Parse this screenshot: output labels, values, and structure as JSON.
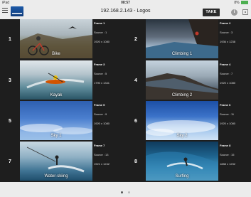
{
  "status": {
    "device": "iPad",
    "time": "08:57",
    "battery": "8%"
  },
  "nav": {
    "title": "192.168.2.143 - Logos",
    "take_label": "TAKE",
    "info_glyph": "i"
  },
  "frames": [
    {
      "num": "1",
      "caption": "Bike",
      "frame": "Frame 1",
      "source": "Source : 1",
      "size": "1920 x 1080"
    },
    {
      "num": "2",
      "caption": "Climbing 1",
      "frame": "Frame 2",
      "source": "Source : 3",
      "size": "1936 x 1238"
    },
    {
      "num": "3",
      "caption": "Kayak",
      "frame": "Frame 3",
      "source": "Source : 5",
      "size": "1790 x 1341"
    },
    {
      "num": "4",
      "caption": "Climbing 2",
      "frame": "Frame 4",
      "source": "Source : 7",
      "size": "1920 x 1080"
    },
    {
      "num": "5",
      "caption": "Sky 1",
      "frame": "Frame 5",
      "source": "Source : 9",
      "size": "1920 x 1080"
    },
    {
      "num": "6",
      "caption": "Sky 2",
      "frame": "Frame 6",
      "source": "Source : 11",
      "size": "1920 x 1080"
    },
    {
      "num": "7",
      "caption": "Water-skiing",
      "frame": "Frame 7",
      "source": "Source : 13",
      "size": "1921 x 1242"
    },
    {
      "num": "8",
      "caption": "Surfing",
      "frame": "Frame 8",
      "source": "Source : 15",
      "size": "1888 x 1232"
    }
  ],
  "pager": {
    "pages": 2,
    "current": 1
  }
}
